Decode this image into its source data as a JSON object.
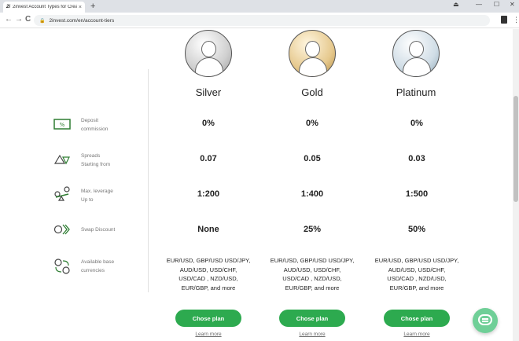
{
  "browser": {
    "tab_title": "2invest Account Types for Crea",
    "tab_favicon": "2i",
    "tab_close": "×",
    "new_tab": "+",
    "url": "2invest.com/en/account-tiers",
    "min": "—",
    "max": "☐",
    "close": "✕",
    "back": "←",
    "forward": "→",
    "reload": "C",
    "menu": "⋮"
  },
  "tiers": [
    {
      "name": "Silver",
      "avatar": "silver"
    },
    {
      "name": "Gold",
      "avatar": "gold"
    },
    {
      "name": "Platinum",
      "avatar": "platinum"
    }
  ],
  "rows": [
    {
      "label": "Deposit\ncommission",
      "icon": "percent-ticket-icon",
      "values": [
        "0%",
        "0%",
        "0%"
      ]
    },
    {
      "label": "Spreads\nStarting from",
      "icon": "spread-triangles-icon",
      "values": [
        "0.07",
        "0.05",
        "0.03"
      ]
    },
    {
      "label": "Max. leverage\nUp to",
      "icon": "leverage-icon",
      "values": [
        "1:200",
        "1:400",
        "1:500"
      ]
    },
    {
      "label": "Swap Discount",
      "icon": "swap-discount-icon",
      "values": [
        "None",
        "25%",
        "50%"
      ]
    },
    {
      "label": "Available base\ncurrencies",
      "icon": "currencies-exchange-icon",
      "values": [
        "EUR/USD, GBP/USD USD/JPY,\nAUD/USD, USD/CHF,\nUSD/CAD , NZD/USD,\nEUR/GBP, and more",
        "EUR/USD, GBP/USD USD/JPY,\nAUD/USD, USD/CHF,\nUSD/CAD , NZD/USD,\nEUR/GBP, and more",
        "EUR/USD, GBP/USD USD/JPY,\nAUD/USD, USD/CHF,\nUSD/CAD , NZD/USD,\nEUR/GBP, and more"
      ]
    }
  ],
  "actions": {
    "chose_plan": "Chose plan",
    "learn_more": "Learn more"
  },
  "colors": {
    "button_green": "#2daa4f",
    "chat_green": "#6fcf97",
    "icon_green": "#2e7d32"
  }
}
